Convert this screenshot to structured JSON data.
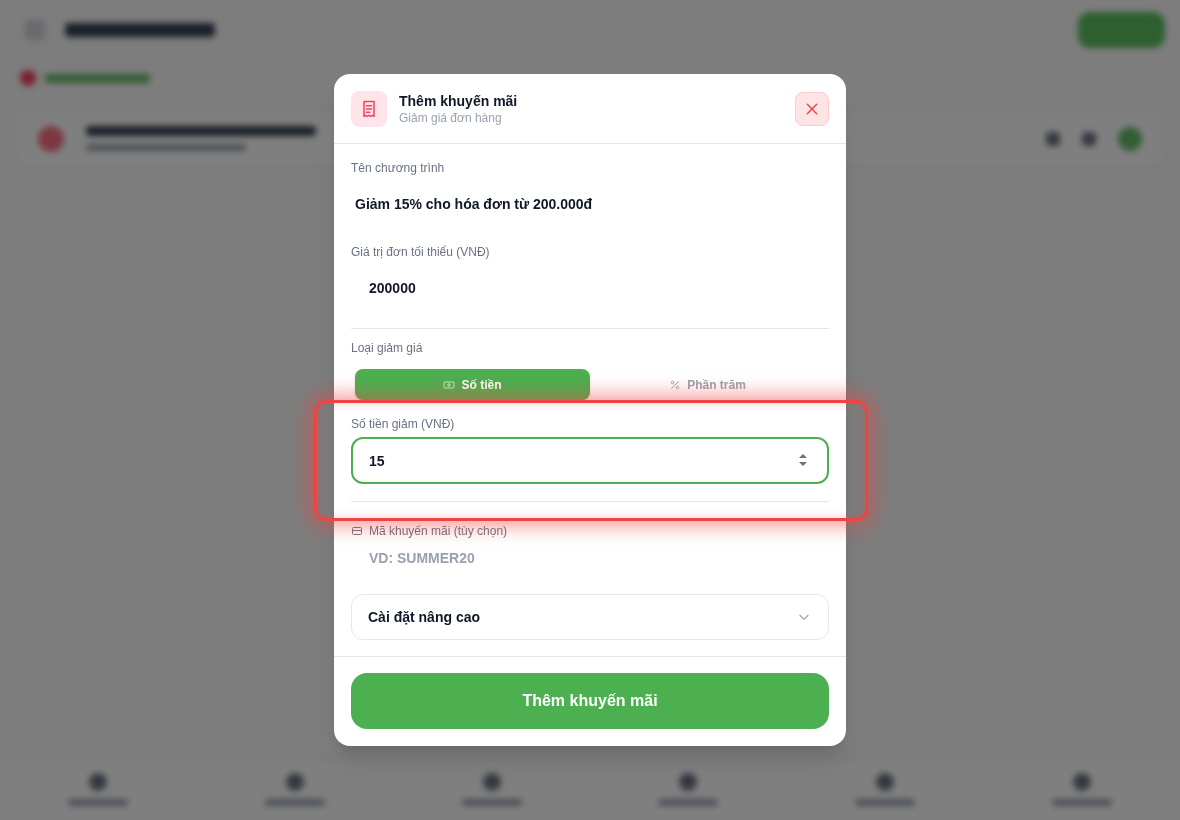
{
  "dialog": {
    "title": "Thêm khuyến mãi",
    "subtitle": "Giảm giá đơn hàng"
  },
  "form": {
    "fields": [
      {
        "kind": "text",
        "label": "Tên chương trình",
        "value": "Giảm 15% cho hóa đơn từ 200.000đ"
      },
      {
        "kind": "number",
        "label": "Giá trị đơn tối thiểu (VNĐ)",
        "value": "200000"
      }
    ],
    "discount_type": {
      "label": "Loại giảm giá",
      "options": [
        {
          "kind": "amount",
          "label": "Số tiền",
          "selected": true
        },
        {
          "kind": "percent",
          "label": "Phần trăm",
          "selected": false
        }
      ]
    },
    "discount_amount": {
      "label": "Số tiền giảm (VNĐ)",
      "value": "15",
      "focused": true,
      "highlighted": true
    },
    "promo_code": {
      "label": "Mã khuyến mãi (tùy chọn)",
      "placeholder": "VD: SUMMER20"
    },
    "advanced": {
      "label": "Cài đặt nâng cao",
      "expanded": false
    }
  },
  "submit_button": {
    "label": "Thêm khuyến mãi"
  }
}
